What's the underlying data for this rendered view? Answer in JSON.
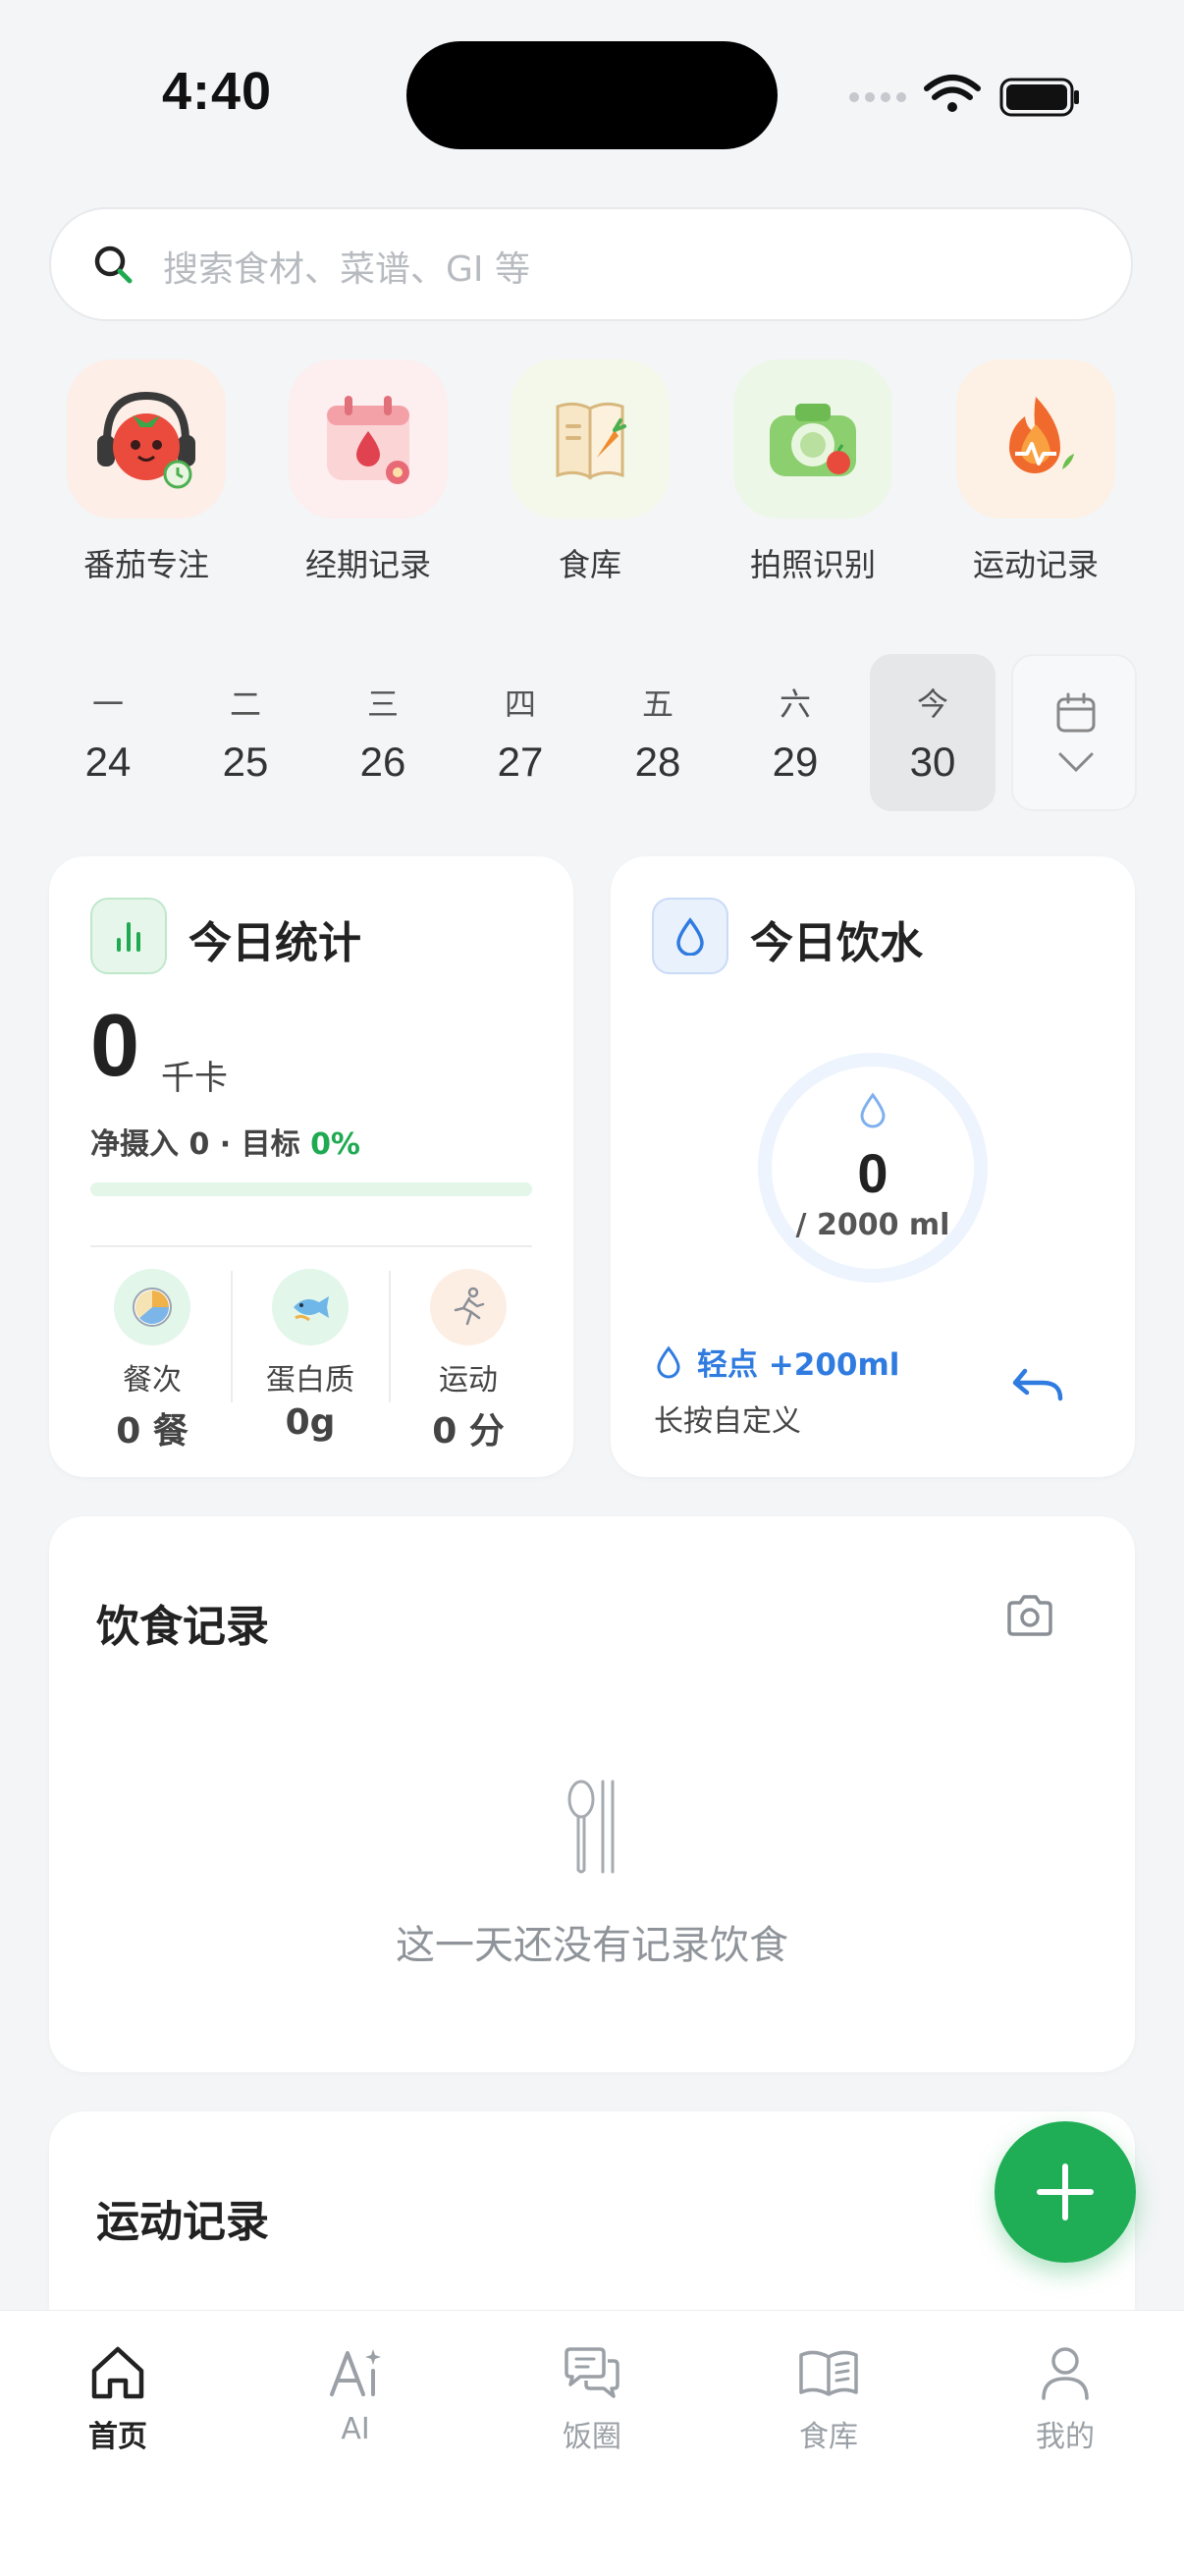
{
  "status": {
    "time": "4:40"
  },
  "search": {
    "placeholder": "搜索食材、菜谱、GI 等"
  },
  "quick_actions": [
    {
      "label": "番茄专注",
      "icon": "tomato-headphones-icon",
      "bg": "#fdeee8"
    },
    {
      "label": "经期记录",
      "icon": "period-calendar-icon",
      "bg": "#fdeef0"
    },
    {
      "label": "食库",
      "icon": "food-book-icon",
      "bg": "#f3f8ea"
    },
    {
      "label": "拍照识别",
      "icon": "camera-icon",
      "bg": "#edf7e8"
    },
    {
      "label": "运动记录",
      "icon": "flame-heartbeat-icon",
      "bg": "#fdf1e6"
    }
  ],
  "week": [
    {
      "weekday": "一",
      "date": "24"
    },
    {
      "weekday": "二",
      "date": "25"
    },
    {
      "weekday": "三",
      "date": "26"
    },
    {
      "weekday": "四",
      "date": "27"
    },
    {
      "weekday": "五",
      "date": "28"
    },
    {
      "weekday": "六",
      "date": "29"
    },
    {
      "weekday": "今",
      "date": "30"
    }
  ],
  "stats": {
    "title": "今日统计",
    "calories": "0",
    "unit": "千卡",
    "net_label": "净摄入 0 · 目标 ",
    "goal_pct": "0%",
    "progress": 0,
    "items": [
      {
        "label": "餐次",
        "value": "0 餐"
      },
      {
        "label": "蛋白质",
        "value": "0g"
      },
      {
        "label": "运动",
        "value": "0 分"
      }
    ]
  },
  "water": {
    "title": "今日饮水",
    "current": "0",
    "target": "/ 2000 ml",
    "progress": 0,
    "quick_add": "轻点 +200ml",
    "hint": "长按自定义"
  },
  "diet": {
    "title": "饮食记录",
    "empty": "这一天还没有记录饮食"
  },
  "exercise": {
    "title": "运动记录"
  },
  "tabs": [
    {
      "label": "首页",
      "icon": "home-icon",
      "active": true
    },
    {
      "label": "AI",
      "icon": "ai-icon",
      "active": false
    },
    {
      "label": "饭圈",
      "icon": "chat-bubbles-icon",
      "active": false
    },
    {
      "label": "食库",
      "icon": "open-book-icon",
      "active": false
    },
    {
      "label": "我的",
      "icon": "profile-icon",
      "active": false
    }
  ],
  "colors": {
    "accent": "#1faa52",
    "water": "#2f7be0"
  }
}
